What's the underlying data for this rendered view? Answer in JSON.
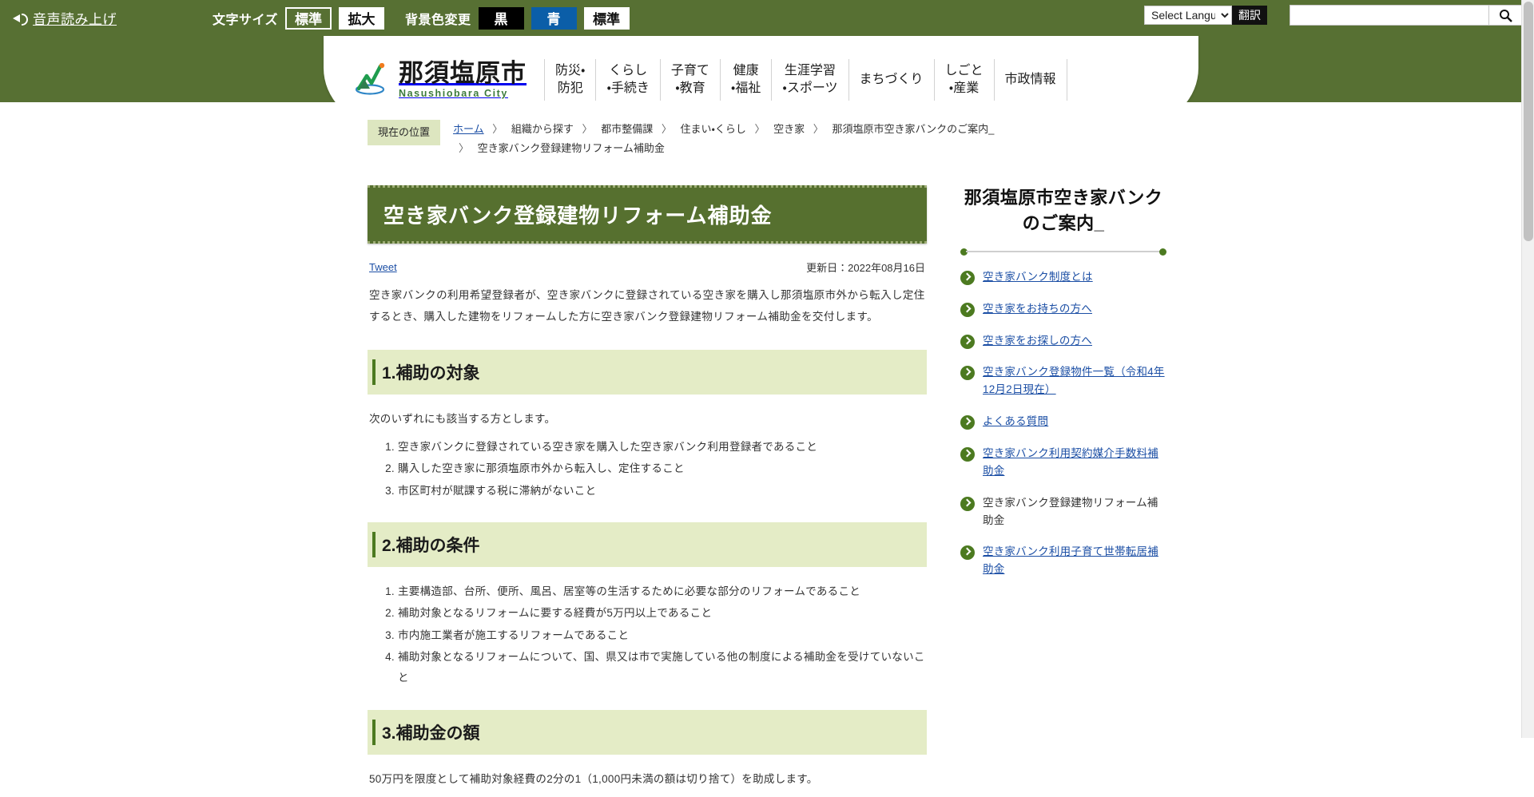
{
  "accessibility_bar": {
    "speak_label": "音声読み上げ",
    "font_size_label": "文字サイズ",
    "font_size_options": [
      "標準",
      "拡大"
    ],
    "bg_color_label": "背景色変更",
    "bg_color_options": [
      "黒",
      "青",
      "標準"
    ],
    "language_select_value": "Select Language",
    "translate_button": "翻訳",
    "search_placeholder": "",
    "search_value": "",
    "search_icon": "search-icon"
  },
  "header": {
    "logo_jp": "那須塩原市",
    "logo_en": "Nasushiobara City",
    "logo_icon": "mountain-logo-icon",
    "nav": [
      {
        "line1": "防災・",
        "line2": "防犯"
      },
      {
        "line1": "くらし",
        "line2": "・手続き"
      },
      {
        "line1": "子育て",
        "line2": "・教育"
      },
      {
        "line1": "健康",
        "line2": "・福祉"
      },
      {
        "line1": "生涯学習",
        "line2": "・スポーツ"
      },
      {
        "line1": "まちづくり",
        "line2": ""
      },
      {
        "line1": "しごと",
        "line2": "・産業"
      },
      {
        "line1": "市政情報",
        "line2": ""
      }
    ]
  },
  "breadcrumb": {
    "badge": "現在の位置",
    "items": [
      {
        "label": "ホーム",
        "link": true
      },
      {
        "label": "組織から探す",
        "link": false
      },
      {
        "label": "都市整備課",
        "link": false
      },
      {
        "label": "住まい・くらし",
        "link": false
      },
      {
        "label": "空き家",
        "link": false
      },
      {
        "label": "那須塩原市空き家バンクのご案内_",
        "link": false
      },
      {
        "label": "空き家バンク登録建物リフォーム補助金",
        "link": false
      }
    ],
    "separator": "〉"
  },
  "main": {
    "page_title": "空き家バンク登録建物リフォーム補助金",
    "tweet_label": "Tweet",
    "update_date": "更新日：2022年08月16日",
    "lead": "空き家バンクの利用希望登録者が、空き家バンクに登録されている空き家を購入し那須塩原市外から転入し定住するとき、購入した建物をリフォームした方に空き家バンク登録建物リフォーム補助金を交付します。",
    "sections": [
      {
        "heading": "1.補助の対象",
        "intro": "次のいずれにも該当する方とします。",
        "items": [
          "空き家バンクに登録されている空き家を購入した空き家バンク利用登録者であること",
          "購入した空き家に那須塩原市外から転入し、定住すること",
          "市区町村が賦課する税に滞納がないこと"
        ]
      },
      {
        "heading": "2.補助の条件",
        "intro": "",
        "items": [
          "主要構造部、台所、便所、風呂、居室等の生活するために必要な部分のリフォームであること",
          "補助対象となるリフォームに要する経費が5万円以上であること",
          "市内施工業者が施工するリフォームであること",
          "補助対象となるリフォームについて、国、県又は市で実施している他の制度による補助金を受けていないこと"
        ]
      },
      {
        "heading": "3.補助金の額",
        "intro": "50万円を限度として補助対象経費の2分の1（1,000円未満の額は切り捨て）を助成します。",
        "items": []
      }
    ]
  },
  "sidebar": {
    "title": "那須塩原市空き家バンクのご案内_",
    "links": [
      {
        "label": "空き家バンク制度とは",
        "current": false
      },
      {
        "label": "空き家をお持ちの方へ",
        "current": false
      },
      {
        "label": "空き家をお探しの方へ",
        "current": false
      },
      {
        "label": "空き家バンク登録物件一覧（令和4年12月2日現在）",
        "current": false
      },
      {
        "label": "よくある質問",
        "current": false
      },
      {
        "label": "空き家バンク利用契約媒介手数料補助金",
        "current": false
      },
      {
        "label": "空き家バンク登録建物リフォーム補助金",
        "current": true
      },
      {
        "label": "空き家バンク利用子育て世帯転居補助金",
        "current": false
      }
    ]
  },
  "colors": {
    "brand_green": "#577033",
    "title_green": "#56702f",
    "section_bg": "#e4ecc6",
    "accent_dark_green": "#4c7a20",
    "link_blue": "#1c4fa5",
    "breadcrumb_badge": "#dde6c0"
  }
}
